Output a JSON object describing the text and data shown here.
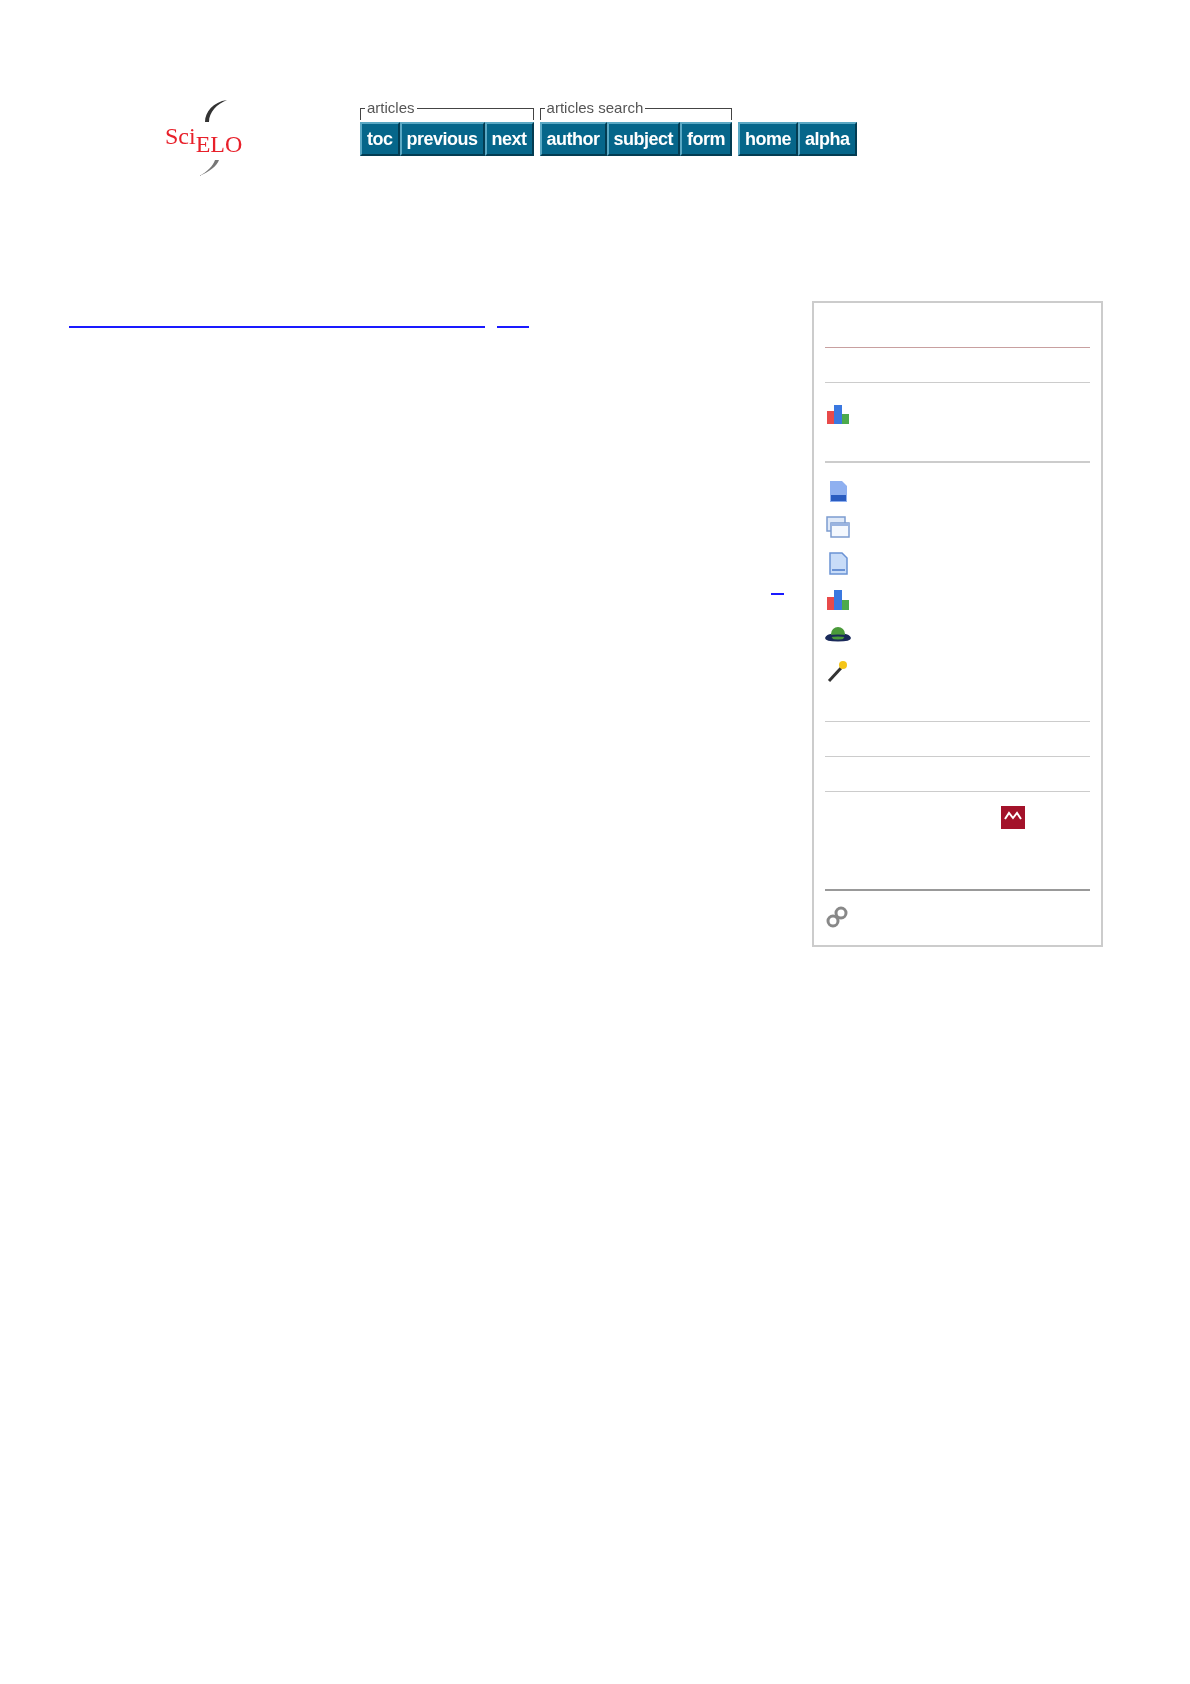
{
  "logo": {
    "left": "Sci",
    "right": "ELO"
  },
  "nav_groups": [
    {
      "label": "articles",
      "buttons": [
        "toc",
        "previous",
        "next"
      ]
    },
    {
      "label": "articles search",
      "buttons": [
        "author",
        "subject",
        "form"
      ]
    },
    {
      "buttons": [
        "home",
        "alpha"
      ]
    }
  ]
}
